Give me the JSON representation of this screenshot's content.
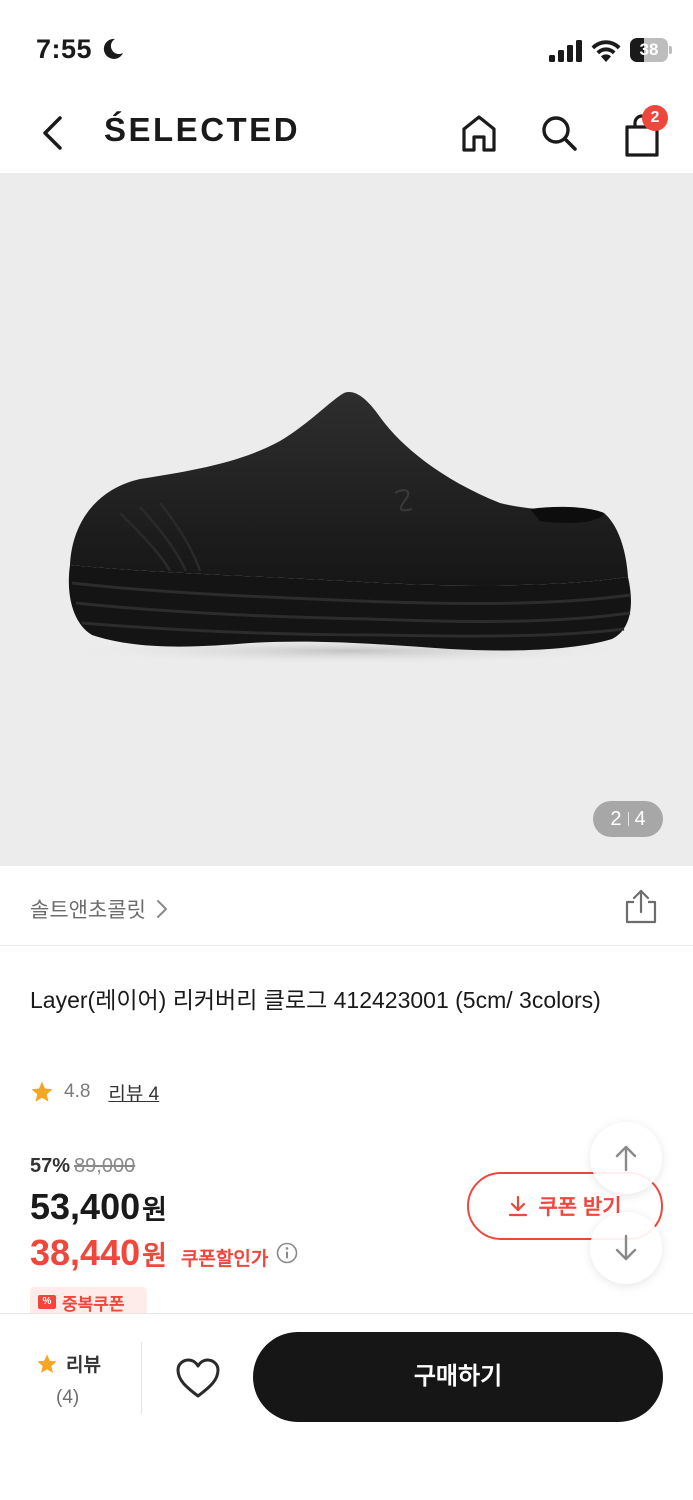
{
  "status_bar": {
    "time": "7:55",
    "battery": "38"
  },
  "header": {
    "brand": "ŚELECTED",
    "cart_count": "2"
  },
  "gallery": {
    "current": "2",
    "total": "4"
  },
  "brand_link": "솔트앤초콜릿",
  "product": {
    "title": "Layer(레이어) 리커버리 클로그 412423001 (5cm/ 3colors)",
    "rating": "4.8",
    "review_label": "리뷰 4"
  },
  "price": {
    "discount_rate": "57%",
    "original": "89,000",
    "sale": "53,400",
    "sale_unit": "원",
    "coupon_price": "38,440",
    "coupon_unit": "원",
    "coupon_label": "쿠폰할인가",
    "dup_coupon": "중복쿠폰"
  },
  "coupon_button": "쿠폰 받기",
  "bottom_bar": {
    "review_label": "리뷰",
    "review_count": "(4)",
    "buy_label": "구매하기"
  },
  "colors": {
    "accent": "#f0473c",
    "buy_button": "#161616",
    "star": "#f5a623",
    "hero_bg": "#ececec"
  },
  "icons": [
    "back-icon",
    "home-icon",
    "search-icon",
    "cart-icon",
    "share-icon",
    "star-icon",
    "info-icon",
    "download-icon",
    "arrow-up-icon",
    "arrow-down-icon",
    "heart-icon",
    "moon-icon",
    "signal-icon",
    "wifi-icon"
  ]
}
